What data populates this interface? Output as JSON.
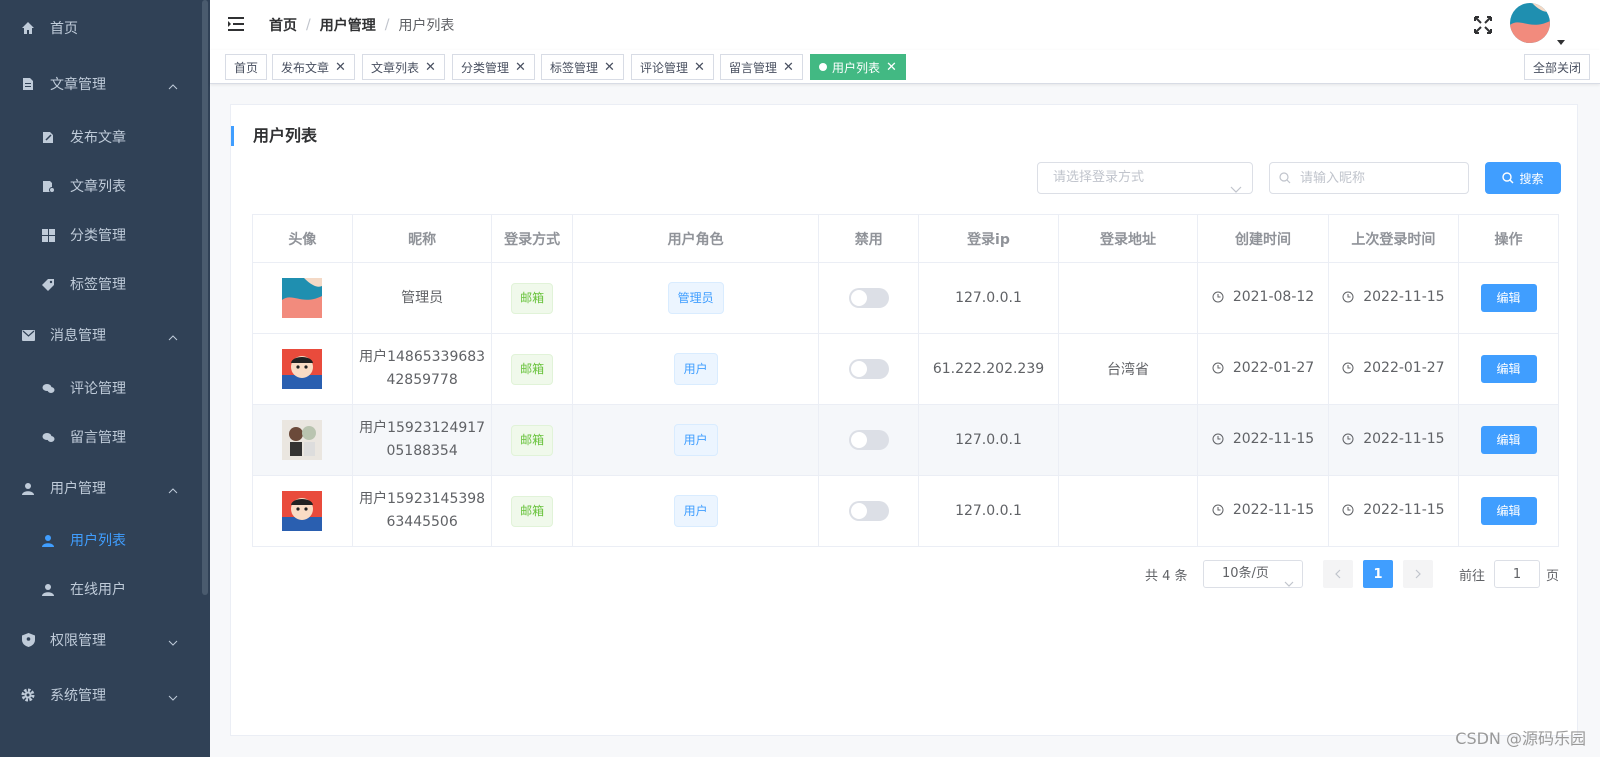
{
  "colors": {
    "sidebar_bg": "#304156",
    "accent": "#409eff",
    "tag_active": "#42b983"
  },
  "sidebar": {
    "items": [
      {
        "label": "首页",
        "icon": "home-icon",
        "level": 1
      },
      {
        "label": "文章管理",
        "icon": "document-icon",
        "level": 1,
        "expanded": true
      },
      {
        "label": "发布文章",
        "icon": "edit-icon",
        "level": 2
      },
      {
        "label": "文章列表",
        "icon": "doc-list-icon",
        "level": 2
      },
      {
        "label": "分类管理",
        "icon": "grid-icon",
        "level": 2
      },
      {
        "label": "标签管理",
        "icon": "price-tag-icon",
        "level": 2
      },
      {
        "label": "消息管理",
        "icon": "mail-icon",
        "level": 1,
        "expanded": true
      },
      {
        "label": "评论管理",
        "icon": "chat-icon",
        "level": 2
      },
      {
        "label": "留言管理",
        "icon": "chat-icon",
        "level": 2
      },
      {
        "label": "用户管理",
        "icon": "user-icon",
        "level": 1,
        "expanded": true
      },
      {
        "label": "用户列表",
        "icon": "user-icon",
        "level": 2,
        "active": true
      },
      {
        "label": "在线用户",
        "icon": "user-icon",
        "level": 2
      },
      {
        "label": "权限管理",
        "icon": "shield-icon",
        "level": 1,
        "expanded": false
      },
      {
        "label": "系统管理",
        "icon": "gear-icon",
        "level": 1,
        "expanded": false
      }
    ]
  },
  "header": {
    "breadcrumb": [
      "首页",
      "用户管理",
      "用户列表"
    ]
  },
  "tags": {
    "items": [
      "首页",
      "发布文章",
      "文章列表",
      "分类管理",
      "标签管理",
      "评论管理",
      "留言管理",
      "用户列表"
    ],
    "active": "用户列表",
    "close_all": "全部关闭"
  },
  "main": {
    "title": "用户列表",
    "login_type_placeholder": "请选择登录方式",
    "nickname_placeholder": "请输入昵称",
    "search_label": "搜索"
  },
  "table": {
    "headers": [
      "头像",
      "昵称",
      "登录方式",
      "用户角色",
      "禁用",
      "登录ip",
      "登录地址",
      "创建时间",
      "上次登录时间",
      "操作"
    ],
    "rows": [
      {
        "nickname": "管理员",
        "login_type": "邮箱",
        "role": "管理员",
        "disabled": false,
        "ip": "127.0.0.1",
        "address": "",
        "created": "2021-08-12",
        "last_login": "2022-11-15",
        "action": "编辑"
      },
      {
        "nickname": "用户1486533968342859778",
        "login_type": "邮箱",
        "role": "用户",
        "disabled": false,
        "ip": "61.222.202.239",
        "address": "台湾省",
        "created": "2022-01-27",
        "last_login": "2022-01-27",
        "action": "编辑"
      },
      {
        "nickname": "用户1592312491705188354",
        "login_type": "邮箱",
        "role": "用户",
        "disabled": false,
        "ip": "127.0.0.1",
        "address": "",
        "created": "2022-11-15",
        "last_login": "2022-11-15",
        "action": "编辑"
      },
      {
        "nickname": "用户1592314539863445506",
        "login_type": "邮箱",
        "role": "用户",
        "disabled": false,
        "ip": "127.0.0.1",
        "address": "",
        "created": "2022-11-15",
        "last_login": "2022-11-15",
        "action": "编辑"
      }
    ]
  },
  "pagination": {
    "total": "共 4 条",
    "page_size": "10条/页",
    "current_page": "1",
    "goto_prefix": "前往",
    "goto_value": "1",
    "goto_suffix": "页"
  },
  "watermark": "CSDN @源码乐园"
}
